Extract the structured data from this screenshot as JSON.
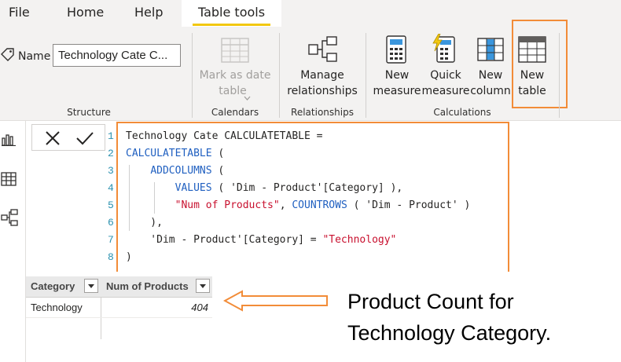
{
  "menu": {
    "items": [
      "File",
      "Home",
      "Help"
    ],
    "active": "Table tools"
  },
  "ribbon": {
    "structure": {
      "name_label": "Name",
      "name_value": "Technology Cate C...",
      "group_label": "Structure"
    },
    "calendars": {
      "mark_line1": "Mark as date",
      "mark_line2": "table",
      "group_label": "Calendars"
    },
    "relationships": {
      "manage_line1": "Manage",
      "manage_line2": "relationships",
      "group_label": "Relationships"
    },
    "calculations": {
      "new_measure_line1": "New",
      "new_measure_line2": "measure",
      "quick_measure_line1": "Quick",
      "quick_measure_line2": "measure",
      "new_column_line1": "New",
      "new_column_line2": "column",
      "new_table_line1": "New",
      "new_table_line2": "table",
      "group_label": "Calculations"
    }
  },
  "formula": {
    "line_numbers": [
      "1",
      "2",
      "3",
      "4",
      "5",
      "6",
      "7",
      "8"
    ],
    "lines": [
      [
        {
          "t": "Technology Cate CALCULATETABLE =",
          "c": "plain"
        }
      ],
      [
        {
          "t": "CALCULATETABLE",
          "c": "kw"
        },
        {
          "t": " (",
          "c": "plain"
        }
      ],
      [
        {
          "t": "    ",
          "c": "plain"
        },
        {
          "t": "ADDCOLUMNS",
          "c": "kw"
        },
        {
          "t": " (",
          "c": "plain"
        }
      ],
      [
        {
          "t": "        ",
          "c": "plain"
        },
        {
          "t": "VALUES",
          "c": "kw"
        },
        {
          "t": " ( 'Dim - Product'[Category] ),",
          "c": "plain"
        }
      ],
      [
        {
          "t": "        ",
          "c": "plain"
        },
        {
          "t": "\"Num of Products\"",
          "c": "str"
        },
        {
          "t": ", ",
          "c": "plain"
        },
        {
          "t": "COUNTROWS",
          "c": "kw"
        },
        {
          "t": " ( 'Dim - Product' )",
          "c": "plain"
        }
      ],
      [
        {
          "t": "    ),",
          "c": "plain"
        }
      ],
      [
        {
          "t": "    'Dim - Product'[Category] = ",
          "c": "plain"
        },
        {
          "t": "\"Technology\"",
          "c": "str"
        }
      ],
      [
        {
          "t": ")",
          "c": "plain"
        }
      ]
    ]
  },
  "table": {
    "columns": [
      "Category",
      "Num of Products"
    ],
    "rows": [
      [
        "Technology",
        "404"
      ]
    ]
  },
  "annotation": {
    "line1": "Product Count for",
    "line2": "Technology Category."
  },
  "colors": {
    "highlight": "#f28c38",
    "accent": "#f2c811",
    "keyword": "#1f5fc0",
    "string": "#c8102e"
  }
}
